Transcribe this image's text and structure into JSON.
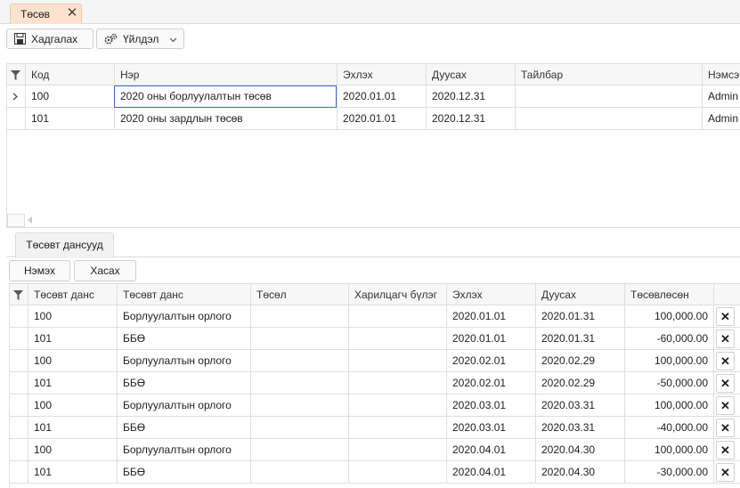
{
  "doc_tab": {
    "label": "Төсөв"
  },
  "toolbar": {
    "save_label": "Хадгалах",
    "action_label": "Үйлдэл"
  },
  "main_grid": {
    "columns": [
      "Код",
      "Нэр",
      "Эхлэх",
      "Дуусах",
      "Тайлбар",
      "Нэмсэн"
    ],
    "rows": [
      {
        "code": "100",
        "name": "2020 оны борлуулалтын төсөв",
        "start": "2020.01.01",
        "end": "2020.12.31",
        "desc": "",
        "added_by": "Admin"
      },
      {
        "code": "101",
        "name": "2020 оны зардлын төсөв",
        "start": "2020.01.01",
        "end": "2020.12.31",
        "desc": "",
        "added_by": "Admin"
      }
    ]
  },
  "detail_tab": {
    "label": "Төсөвт дансууд"
  },
  "detail_toolbar": {
    "add_label": "Нэмэх",
    "delete_label": "Хасах"
  },
  "detail_grid": {
    "columns": [
      "Төсөвт данс",
      "Төсөвт данс",
      "Төсөл",
      "Харилцагч бүлэг",
      "Эхлэх",
      "Дуусах",
      "Төсөвлөсөн"
    ],
    "rows": [
      {
        "account": "100",
        "account_name": "Борлуулалтын орлого",
        "project": "",
        "partner_group": "",
        "start": "2020.01.01",
        "end": "2020.01.31",
        "amount": "100,000.00"
      },
      {
        "account": "101",
        "account_name": "ББӨ",
        "project": "",
        "partner_group": "",
        "start": "2020.01.01",
        "end": "2020.01.31",
        "amount": "-60,000.00"
      },
      {
        "account": "100",
        "account_name": "Борлуулалтын орлого",
        "project": "",
        "partner_group": "",
        "start": "2020.02.01",
        "end": "2020.02.29",
        "amount": "100,000.00"
      },
      {
        "account": "101",
        "account_name": "ББӨ",
        "project": "",
        "partner_group": "",
        "start": "2020.02.01",
        "end": "2020.02.29",
        "amount": "-50,000.00"
      },
      {
        "account": "100",
        "account_name": "Борлуулалтын орлого",
        "project": "",
        "partner_group": "",
        "start": "2020.03.01",
        "end": "2020.03.31",
        "amount": "100,000.00"
      },
      {
        "account": "101",
        "account_name": "ББӨ",
        "project": "",
        "partner_group": "",
        "start": "2020.03.01",
        "end": "2020.03.31",
        "amount": "-40,000.00"
      },
      {
        "account": "100",
        "account_name": "Борлуулалтын орлого",
        "project": "",
        "partner_group": "",
        "start": "2020.04.01",
        "end": "2020.04.30",
        "amount": "100,000.00"
      },
      {
        "account": "101",
        "account_name": "ББӨ",
        "project": "",
        "partner_group": "",
        "start": "2020.04.01",
        "end": "2020.04.30",
        "amount": "-30,000.00"
      }
    ]
  },
  "icons": {
    "save": "floppy-icon",
    "action": "gears-icon",
    "filter": "filter-icon",
    "row_indicator": "chevron-right-icon",
    "delete_row": "close-icon"
  },
  "colors": {
    "active_tab_bg": "#fde3cf",
    "focus_outline": "#3b6cc9",
    "grid_line": "#dedede"
  }
}
